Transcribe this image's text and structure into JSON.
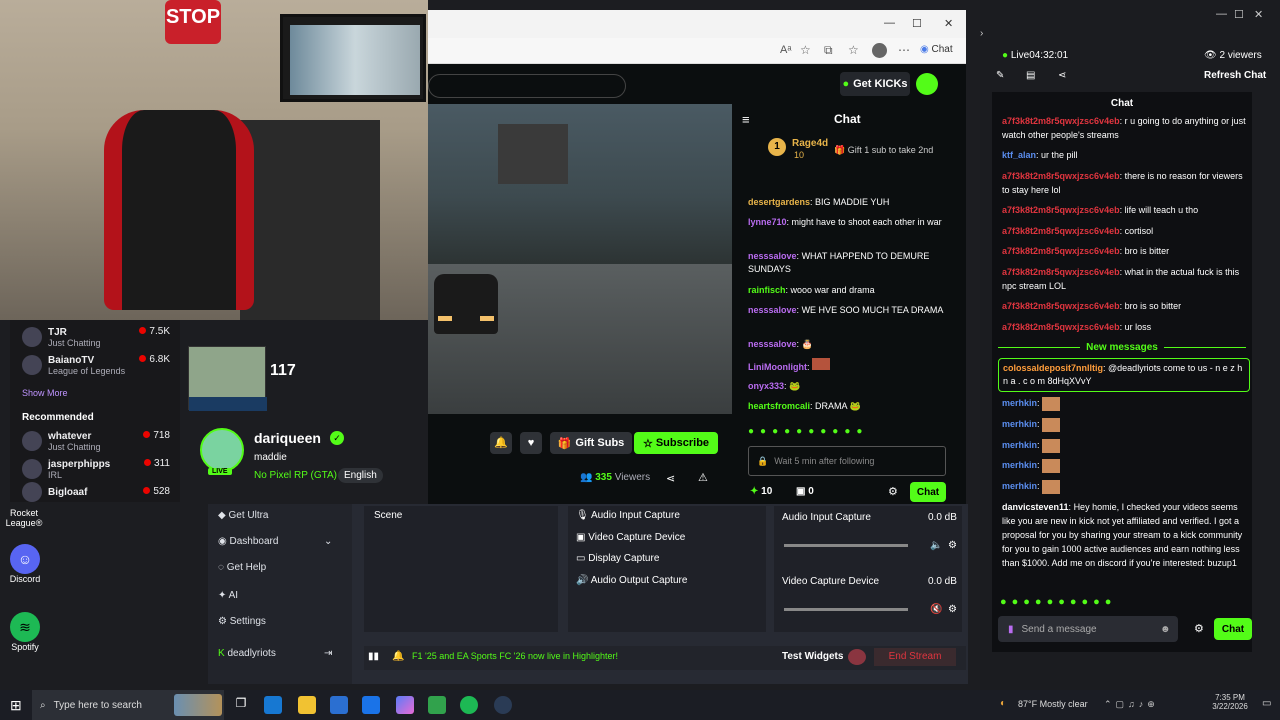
{
  "webcam": {
    "sign_text": "STOP"
  },
  "left_sidebar": {
    "channels": [
      {
        "name": "TJR",
        "category": "Just Chatting",
        "viewers": "7.5K"
      },
      {
        "name": "BaianoTV",
        "category": "League of Legends",
        "viewers": "6.8K"
      }
    ],
    "show_more": "Show More",
    "recommended_heading": "Recommended",
    "recommended": [
      {
        "name": "whatever",
        "category": "Just Chatting",
        "viewers": "718"
      },
      {
        "name": "jasperphipps",
        "category": "IRL",
        "viewers": "311"
      },
      {
        "name": "Bigloaaf",
        "category": "",
        "viewers": "528"
      }
    ]
  },
  "desktop_icons": [
    {
      "label": "Rocket League®"
    },
    {
      "label": "Discord"
    },
    {
      "label": "Spotify"
    }
  ],
  "browser": {
    "window_controls": [
      "—",
      "☐",
      "✕"
    ],
    "toolbar": {
      "chat_label": "Chat"
    },
    "header": {
      "get_kicks": "Get KICKs"
    },
    "stream": {
      "streamer": "dariqueen",
      "title": "maddie",
      "category": "No Pixel RP (GTA)",
      "language": "English",
      "gift_subs": "Gift Subs",
      "subscribe": "Subscribe",
      "viewers_count": "335",
      "viewers_label": "Viewers",
      "speed": "117",
      "live_badge": "LIVE"
    },
    "chat": {
      "title": "Chat",
      "gifter_name": "Rage4d",
      "gifter_count": "10",
      "gift_prompt": "Gift 1 sub to take 2nd",
      "messages": [
        {
          "user": "desertgardens",
          "text": "BIG MADDIE YUH",
          "color": "#e8b44a"
        },
        {
          "user": "lynne710",
          "text": "might have to shoot each other in war",
          "color": "#b96cf0"
        },
        {
          "user": "nesssalove",
          "text": "WHAT HAPPEND TO DEMURE SUNDAYS",
          "color": "#b96cf0"
        },
        {
          "user": "rainfisch",
          "text": "wooo war and drama",
          "color": "#53fc18"
        },
        {
          "user": "nesssalove",
          "text": "WE HVE SOO MUCH TEA DRAMA",
          "color": "#b96cf0"
        },
        {
          "user": "nesssalove",
          "text": "",
          "color": "#b96cf0"
        },
        {
          "user": "LiniMoonlight",
          "text": "",
          "color": "#b96cf0"
        },
        {
          "user": "onyx333",
          "text": "",
          "color": "#b96cf0"
        },
        {
          "user": "heartsfromcali",
          "text": "DRAMA",
          "color": "#53fc18"
        }
      ],
      "input_placeholder": "Wait 5 min after following",
      "points": "10",
      "gifts": "0",
      "send_label": "Chat"
    }
  },
  "obs": {
    "menu": [
      "Get Ultra",
      "Dashboard",
      "Get Help",
      "AI",
      "Settings",
      "deadlyriots"
    ],
    "scene_label": "Scene",
    "sources": [
      "Audio Input Capture",
      "Video Capture Device",
      "Display Capture",
      "Audio Output Capture"
    ],
    "mixer": [
      {
        "name": "Audio Input Capture",
        "level": "0.0 dB"
      },
      {
        "name": "Video Capture Device",
        "level": "0.0 dB"
      }
    ],
    "notice": "F1 '25 and EA Sports FC '26 now live in Highlighter!",
    "test_widgets": "Test Widgets",
    "end_stream": "End Stream"
  },
  "right_app": {
    "live_status": "Live",
    "live_time": "04:32:01",
    "viewers": "2 viewers",
    "refresh": "Refresh Chat",
    "chat_title": "Chat",
    "messages": [
      {
        "user": "a7f3k8t2m8r5qwxjzsc6v4eb",
        "text": "r u going to do anything or just watch other people's streams",
        "kind": "red"
      },
      {
        "user": "ktf_alan",
        "text": "ur the pill",
        "kind": "blue"
      },
      {
        "user": "a7f3k8t2m8r5qwxjzsc6v4eb",
        "text": "there is no reason for viewers to stay here lol",
        "kind": "red"
      },
      {
        "user": "a7f3k8t2m8r5qwxjzsc6v4eb",
        "text": "life will teach u tho",
        "kind": "red"
      },
      {
        "user": "a7f3k8t2m8r5qwxjzsc6v4eb",
        "text": "cortisol",
        "kind": "red"
      },
      {
        "user": "a7f3k8t2m8r5qwxjzsc6v4eb",
        "text": "bro is bitter",
        "kind": "red"
      },
      {
        "user": "a7f3k8t2m8r5qwxjzsc6v4eb",
        "text": "what in the actual fuck is this npc stream LOL",
        "kind": "red"
      },
      {
        "user": "a7f3k8t2m8r5qwxjzsc6v4eb",
        "text": "bro is so bitter",
        "kind": "red"
      },
      {
        "user": "a7f3k8t2m8r5qwxjzsc6v4eb",
        "text": "ur loss",
        "kind": "red"
      }
    ],
    "new_messages": "New messages",
    "highlight": {
      "user": "colossaldeposit7nnlltig",
      "text": "@deadlyriots come to us - n e z h n a . c o m 8dHqXVvY"
    },
    "merhkin_user": "merhkin",
    "long_msg": {
      "user": "danvicsteven11",
      "text": "Hey homie, I checked your videos seems like you are new in kick not yet affiliated and verified. I got a proposal for you by sharing your stream to a kick community for you to gain 1000 active audiences and earn nothing less than $1000. Add me on discord if you're interested: buzup1"
    },
    "input_placeholder": "Send a message",
    "send": "Chat"
  },
  "taskbar": {
    "search_placeholder": "Type here to search",
    "weather": "87°F  Mostly clear",
    "time": "7:35 PM",
    "date": "3/22/2026"
  }
}
